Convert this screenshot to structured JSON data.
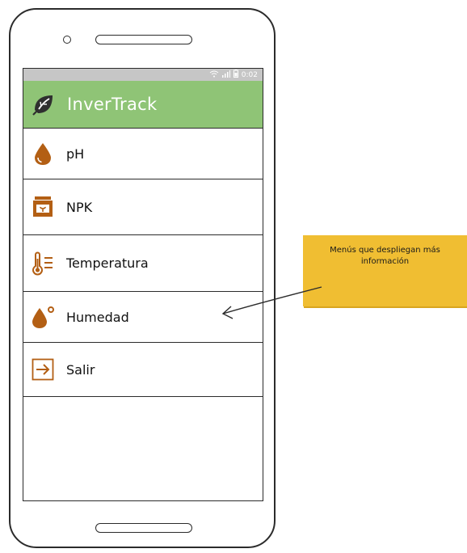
{
  "status_bar": {
    "time": "0:02",
    "icons": [
      "wifi-icon",
      "signal-icon",
      "battery-icon"
    ]
  },
  "app_bar": {
    "title": "InverTrack",
    "logo_icon": "leaf-icon",
    "color": "#8fc476"
  },
  "menu": {
    "items": [
      {
        "label": "pH",
        "icon": "water-drop-icon"
      },
      {
        "label": "NPK",
        "icon": "fertilizer-bag-icon"
      },
      {
        "label": "Temperatura",
        "icon": "thermometer-icon"
      },
      {
        "label": "Humedad",
        "icon": "humidity-icon"
      },
      {
        "label": "Salir",
        "icon": "exit-icon"
      }
    ],
    "icon_color": "#b35f14"
  },
  "annotation": {
    "text": "Menús que despliegan más información",
    "color": "#f0be32"
  }
}
